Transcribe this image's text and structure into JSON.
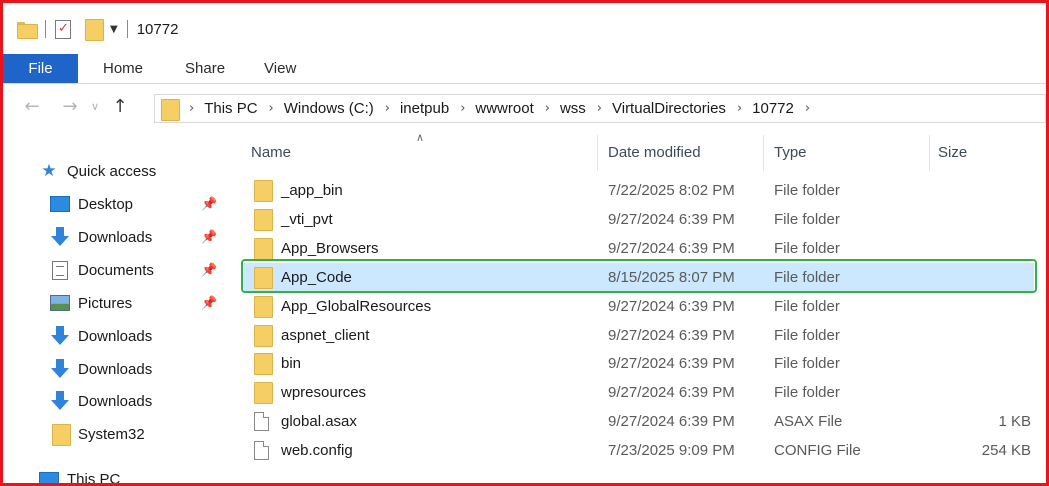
{
  "title_bar": {
    "title": "10772"
  },
  "ribbon": {
    "tabs": [
      "File",
      "Home",
      "Share",
      "View"
    ]
  },
  "address": {
    "crumbs": [
      "This PC",
      "Windows (C:)",
      "inetpub",
      "wwwroot",
      "wss",
      "VirtualDirectories",
      "10772"
    ]
  },
  "sidebar": {
    "items": [
      {
        "label": "Quick access",
        "icon": "star-icon",
        "pinned": false
      },
      {
        "label": "Desktop",
        "icon": "desktop-icon",
        "pinned": true
      },
      {
        "label": "Downloads",
        "icon": "download-icon",
        "pinned": true
      },
      {
        "label": "Documents",
        "icon": "documents-icon",
        "pinned": true
      },
      {
        "label": "Pictures",
        "icon": "pictures-icon",
        "pinned": true
      },
      {
        "label": "Downloads",
        "icon": "download-icon",
        "pinned": false
      },
      {
        "label": "Downloads",
        "icon": "download-icon",
        "pinned": false
      },
      {
        "label": "Downloads",
        "icon": "download-icon",
        "pinned": false
      },
      {
        "label": "System32",
        "icon": "folder-icon",
        "pinned": false
      },
      {
        "label": "This PC",
        "icon": "computer-icon",
        "pinned": false
      }
    ]
  },
  "columns": {
    "name": "Name",
    "date": "Date modified",
    "type": "Type",
    "size": "Size"
  },
  "files": [
    {
      "name": "_app_bin",
      "date": "7/22/2025 8:02 PM",
      "type": "File folder",
      "size": "",
      "icon": "folder-icon"
    },
    {
      "name": "_vti_pvt",
      "date": "9/27/2024 6:39 PM",
      "type": "File folder",
      "size": "",
      "icon": "folder-icon"
    },
    {
      "name": "App_Browsers",
      "date": "9/27/2024 6:39 PM",
      "type": "File folder",
      "size": "",
      "icon": "folder-icon"
    },
    {
      "name": "App_Code",
      "date": "8/15/2025 8:07 PM",
      "type": "File folder",
      "size": "",
      "icon": "folder-icon"
    },
    {
      "name": "App_GlobalResources",
      "date": "9/27/2024 6:39 PM",
      "type": "File folder",
      "size": "",
      "icon": "folder-icon"
    },
    {
      "name": "aspnet_client",
      "date": "9/27/2024 6:39 PM",
      "type": "File folder",
      "size": "",
      "icon": "folder-icon"
    },
    {
      "name": "bin",
      "date": "9/27/2024 6:39 PM",
      "type": "File folder",
      "size": "",
      "icon": "folder-icon"
    },
    {
      "name": "wpresources",
      "date": "9/27/2024 6:39 PM",
      "type": "File folder",
      "size": "",
      "icon": "folder-icon"
    },
    {
      "name": "global.asax",
      "date": "9/27/2024 6:39 PM",
      "type": "ASAX File",
      "size": "1 KB",
      "icon": "file-icon"
    },
    {
      "name": "web.config",
      "date": "7/23/2025 9:09 PM",
      "type": "CONFIG File",
      "size": "254 KB",
      "icon": "file-icon"
    }
  ],
  "colors": {
    "frame_border": "#e8141b",
    "file_tab": "#1f64c8",
    "highlight": "#34b04a",
    "selection": "#cce8ff"
  }
}
